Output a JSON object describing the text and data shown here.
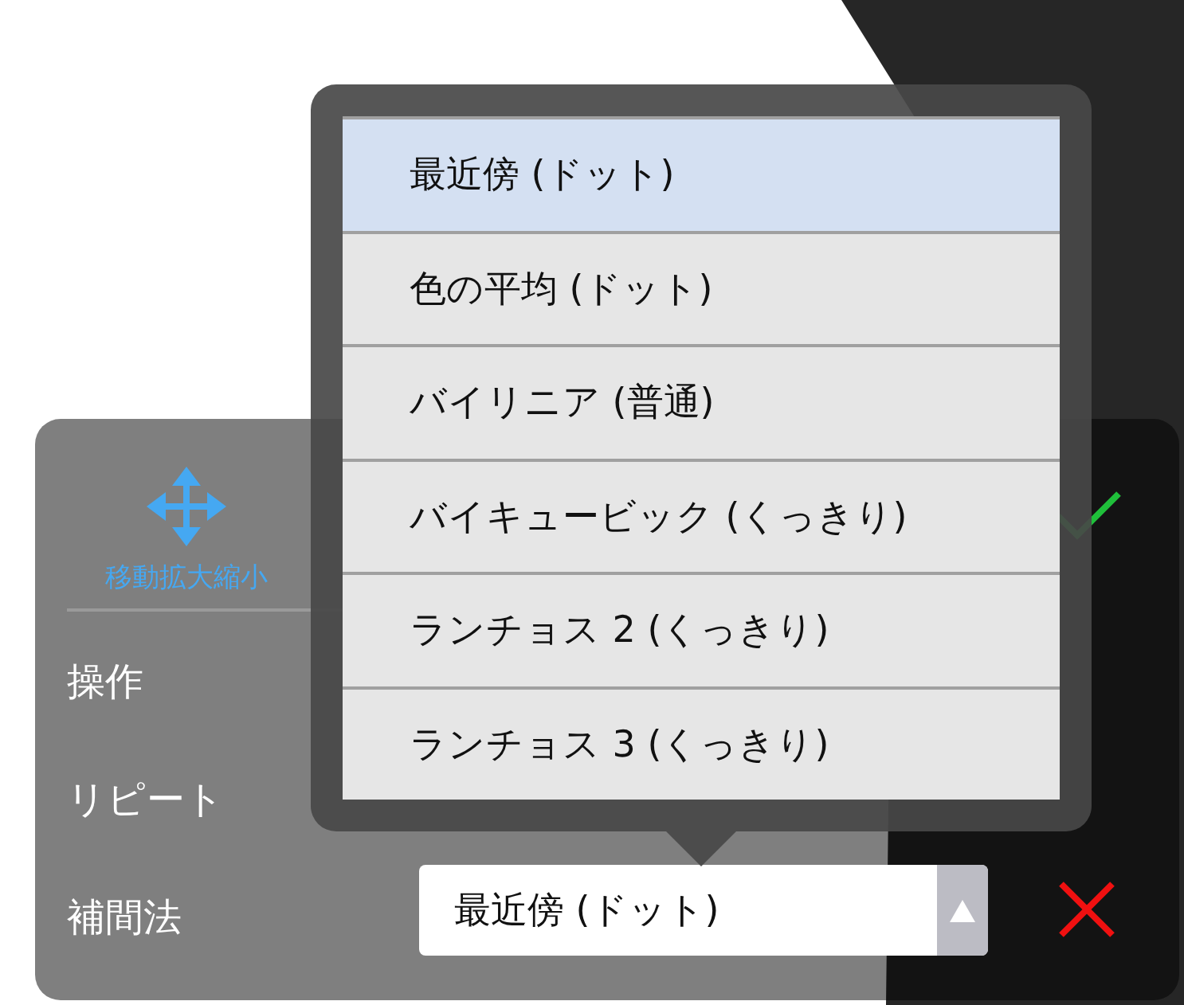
{
  "tool": {
    "label": "移動拡大縮小"
  },
  "rows": [
    {
      "label": "操作"
    },
    {
      "label": "リピート"
    },
    {
      "label": "補間法"
    }
  ],
  "interpolation": {
    "value": "最近傍 (ドット)",
    "options": [
      {
        "label": "最近傍 (ドット)",
        "selected": true
      },
      {
        "label": "色の平均 (ドット)",
        "selected": false
      },
      {
        "label": "バイリニア (普通)",
        "selected": false
      },
      {
        "label": "バイキュービック (くっきり)",
        "selected": false
      },
      {
        "label": "ランチョス 2 (くっきり)",
        "selected": false
      },
      {
        "label": "ランチョス 3 (くっきり)",
        "selected": false
      }
    ]
  }
}
